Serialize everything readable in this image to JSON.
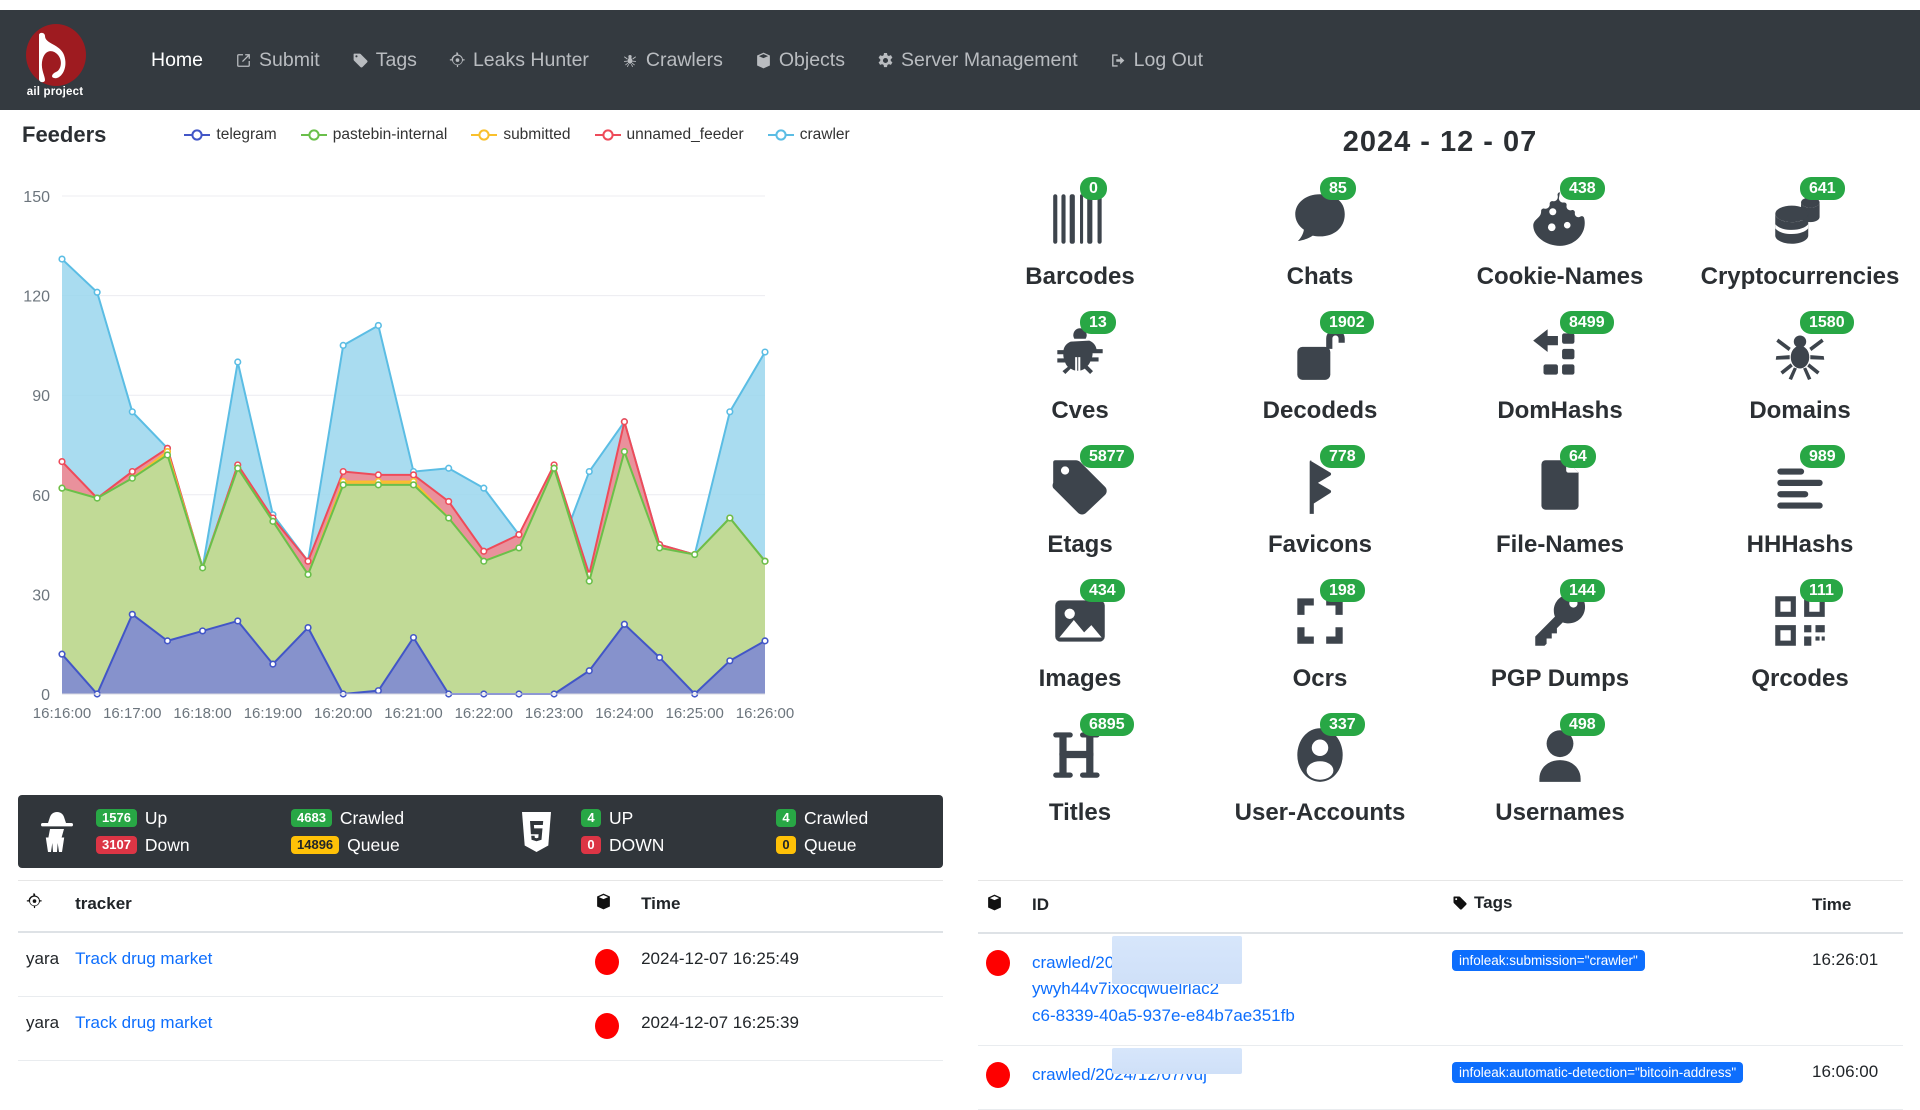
{
  "brand": {
    "name": "ail project",
    "logo_color": "#9e1b20"
  },
  "nav": {
    "items": [
      {
        "label": "Home",
        "icon": "none",
        "active": true
      },
      {
        "label": "Submit",
        "icon": "external-link-icon",
        "active": false
      },
      {
        "label": "Tags",
        "icon": "tag-icon",
        "active": false
      },
      {
        "label": "Leaks Hunter",
        "icon": "crosshair-icon",
        "active": false
      },
      {
        "label": "Crawlers",
        "icon": "spider-icon",
        "active": false
      },
      {
        "label": "Objects",
        "icon": "cube-icon",
        "active": false
      },
      {
        "label": "Server Management",
        "icon": "gear-icon",
        "active": false
      },
      {
        "label": "Log Out",
        "icon": "logout-icon",
        "active": false
      }
    ]
  },
  "feeders": {
    "title": "Feeders",
    "legend": [
      {
        "label": "telegram",
        "color": "#4256c7"
      },
      {
        "label": "pastebin-internal",
        "color": "#6abf4b"
      },
      {
        "label": "submitted",
        "color": "#f9c02c"
      },
      {
        "label": "unnamed_feeder",
        "color": "#ee4b5a"
      },
      {
        "label": "crawler",
        "color": "#5bbde4"
      }
    ]
  },
  "chart_data": {
    "type": "area",
    "title": "Feeders",
    "xlabel": "",
    "ylabel": "",
    "ylim": [
      0,
      150
    ],
    "yticks": [
      0,
      30,
      60,
      90,
      120,
      150
    ],
    "grid": true,
    "legend_position": "top",
    "stacked": true,
    "x": [
      "16:16:00",
      "16:16:30",
      "16:17:00",
      "16:17:30",
      "16:18:00",
      "16:18:30",
      "16:19:00",
      "16:19:30",
      "16:20:00",
      "16:20:30",
      "16:21:00",
      "16:21:30",
      "16:22:00",
      "16:22:30",
      "16:23:00",
      "16:23:30",
      "16:24:00",
      "16:24:30",
      "16:25:00",
      "16:25:30",
      "16:26:00"
    ],
    "tick_labels": [
      "16:16:00",
      "16:17:00",
      "16:18:00",
      "16:19:00",
      "16:20:00",
      "16:21:00",
      "16:22:00",
      "16:23:00",
      "16:24:00",
      "16:25:00",
      "16:26:00"
    ],
    "series": [
      {
        "name": "telegram",
        "color": "#4256c7",
        "fill": "#7b85d6",
        "values": [
          12,
          0,
          24,
          16,
          19,
          22,
          9,
          20,
          0,
          1,
          17,
          0,
          0,
          0,
          0,
          7,
          21,
          11,
          0,
          10,
          16
        ]
      },
      {
        "name": "pastebin-internal",
        "color": "#6abf4b",
        "fill": "#b7dfa6",
        "values": [
          62,
          59,
          65,
          72,
          38,
          68,
          52,
          36,
          63,
          63,
          63,
          53,
          40,
          44,
          68,
          34,
          73,
          44,
          42,
          53,
          40
        ]
      },
      {
        "name": "submitted",
        "color": "#f9c02c",
        "fill": "#f9c02c",
        "values": [
          62,
          59,
          65,
          73,
          38,
          68,
          52,
          36,
          64,
          64,
          64,
          53,
          40,
          44,
          68,
          34,
          73,
          44,
          42,
          53,
          40
        ]
      },
      {
        "name": "unnamed_feeder",
        "color": "#ee4b5a",
        "fill": "#f4848d",
        "values": [
          70,
          59,
          67,
          74,
          38,
          69,
          53,
          40,
          67,
          66,
          66,
          58,
          43,
          48,
          69,
          36,
          82,
          45,
          42,
          53,
          40
        ]
      },
      {
        "name": "crawler",
        "color": "#5bbde4",
        "fill": "#9ad6ed",
        "values": [
          131,
          121,
          85,
          74,
          38,
          100,
          54,
          40,
          105,
          111,
          67,
          68,
          62,
          48,
          39,
          67,
          82,
          45,
          42,
          85,
          103
        ]
      }
    ]
  },
  "status": {
    "icon": "detective-icon",
    "groups": [
      {
        "icon": "detective-icon",
        "metrics": [
          [
            {
              "value": "1576",
              "label": "Up",
              "color": "green"
            },
            {
              "value": "3107",
              "label": "Down",
              "color": "red"
            }
          ],
          [
            {
              "value": "4683",
              "label": "Crawled",
              "color": "green"
            },
            {
              "value": "14896",
              "label": "Queue",
              "color": "yellow"
            }
          ]
        ]
      },
      {
        "icon": "html5-icon",
        "metrics": [
          [
            {
              "value": "4",
              "label": "UP",
              "color": "green"
            },
            {
              "value": "0",
              "label": "DOWN",
              "color": "red"
            }
          ],
          [
            {
              "value": "4",
              "label": "Crawled",
              "color": "green"
            },
            {
              "value": "0",
              "label": "Queue",
              "color": "yellow"
            }
          ]
        ]
      }
    ]
  },
  "objects": {
    "date": "2024 - 12 - 07",
    "badge_color": "#28a745",
    "items": [
      {
        "label": "Barcodes",
        "count": "0",
        "icon": "barcode-icon"
      },
      {
        "label": "Chats",
        "count": "85",
        "icon": "chat-bubble-icon"
      },
      {
        "label": "Cookie-Names",
        "count": "438",
        "icon": "cookie-icon"
      },
      {
        "label": "Cryptocurrencies",
        "count": "641",
        "icon": "coins-icon"
      },
      {
        "label": "Cves",
        "count": "13",
        "icon": "bug-icon"
      },
      {
        "label": "Decodeds",
        "count": "1902",
        "icon": "unlock-icon"
      },
      {
        "label": "DomHashs",
        "count": "8499",
        "icon": "sitemap-icon"
      },
      {
        "label": "Domains",
        "count": "1580",
        "icon": "spider-icon"
      },
      {
        "label": "Etags",
        "count": "5877",
        "icon": "tag-icon"
      },
      {
        "label": "Favicons",
        "count": "778",
        "icon": "flag-icon"
      },
      {
        "label": "File-Names",
        "count": "64",
        "icon": "file-icon"
      },
      {
        "label": "HHHashs",
        "count": "989",
        "icon": "align-left-icon"
      },
      {
        "label": "Images",
        "count": "434",
        "icon": "image-icon"
      },
      {
        "label": "Ocrs",
        "count": "198",
        "icon": "expand-icon"
      },
      {
        "label": "PGP Dumps",
        "count": "144",
        "icon": "key-icon"
      },
      {
        "label": "Qrcodes",
        "count": "111",
        "icon": "qrcode-icon"
      },
      {
        "label": "Titles",
        "count": "6895",
        "icon": "heading-icon"
      },
      {
        "label": "User-Accounts",
        "count": "337",
        "icon": "user-circle-icon"
      },
      {
        "label": "Usernames",
        "count": "498",
        "icon": "user-icon"
      }
    ]
  },
  "trackers_table": {
    "headers": [
      "",
      "tracker",
      "",
      "Time"
    ],
    "header_icons": [
      "crosshair-icon",
      null,
      "cube-icon",
      null
    ],
    "rows": [
      {
        "type": "yara",
        "name": "Track drug market",
        "status": "red",
        "time": "2024-12-07 16:25:49"
      },
      {
        "type": "yara",
        "name": "Track drug market",
        "status": "red",
        "time": "2024-12-07 16:25:39"
      }
    ]
  },
  "objects_table": {
    "headers": [
      "",
      "ID",
      "Tags",
      "Time"
    ],
    "header_icons": [
      "cube-icon",
      null,
      "tag-icon",
      null
    ],
    "rows": [
      {
        "status": "red",
        "id_line1_prefix": "crawled/2024/12/07/",
        "id_line1_suffix": "yxwj",
        "id_line2_prefix": "ywyh44v7ixocqwuelrl",
        "id_line2_suffix": "ac2",
        "id_line3": "c6-8339-40a5-937e-e84b7ae351fb",
        "tag": "infoleak:submission=\"crawler\"",
        "time": "16:26:01"
      },
      {
        "status": "red",
        "id_line1_prefix": "crawled/2024/12/07/",
        "id_line1_suffix": "vuj",
        "id_line2_prefix": "",
        "id_line2_suffix": "",
        "id_line3": "",
        "tag": "infoleak:automatic-detection=\"bitcoin-address\"",
        "time": "16:06:00"
      }
    ]
  }
}
